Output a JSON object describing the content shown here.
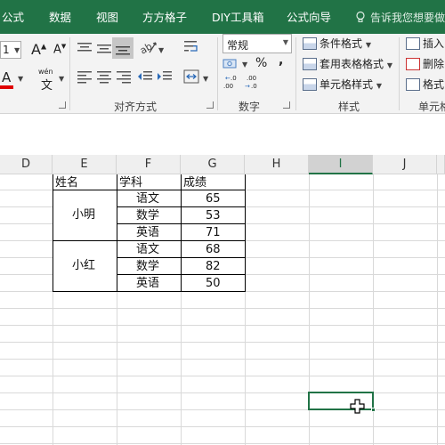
{
  "menu": [
    "公式",
    "数据",
    "视图",
    "方方格子",
    "DIY工具箱",
    "公式向导"
  ],
  "tell_me": "告诉我您想要做",
  "ribbon": {
    "font_size_value": "1",
    "grow_font": "A",
    "shrink_font": "A",
    "font_color_glyph": "A",
    "phonetic_glyph": "wén",
    "phonetic_char": "文",
    "number_format": "常规",
    "percent": "%",
    "comma": ",",
    "dec_inc": ".00",
    "dec_dec": ".0",
    "cond_format": "条件格式",
    "table_format": "套用表格格式",
    "cell_style": "单元格样式",
    "insert": "插入",
    "delete": "删除",
    "format": "格式",
    "groups": {
      "align": "对齐方式",
      "number": "数字",
      "style": "样式",
      "cells": "单元格"
    },
    "accent_color": "#217346",
    "font_color_bar": "#e00000"
  },
  "columns": [
    "D",
    "E",
    "F",
    "G",
    "H",
    "I",
    "J"
  ],
  "selected_column": "I",
  "table": {
    "headers": [
      "姓名",
      "学科",
      "成绩"
    ],
    "groups": [
      {
        "name": "小明",
        "rows": [
          {
            "subject": "语文",
            "score": "65"
          },
          {
            "subject": "数学",
            "score": "53"
          },
          {
            "subject": "英语",
            "score": "71"
          }
        ]
      },
      {
        "name": "小红",
        "rows": [
          {
            "subject": "语文",
            "score": "68"
          },
          {
            "subject": "数学",
            "score": "82"
          },
          {
            "subject": "英语",
            "score": "50"
          }
        ]
      }
    ]
  }
}
